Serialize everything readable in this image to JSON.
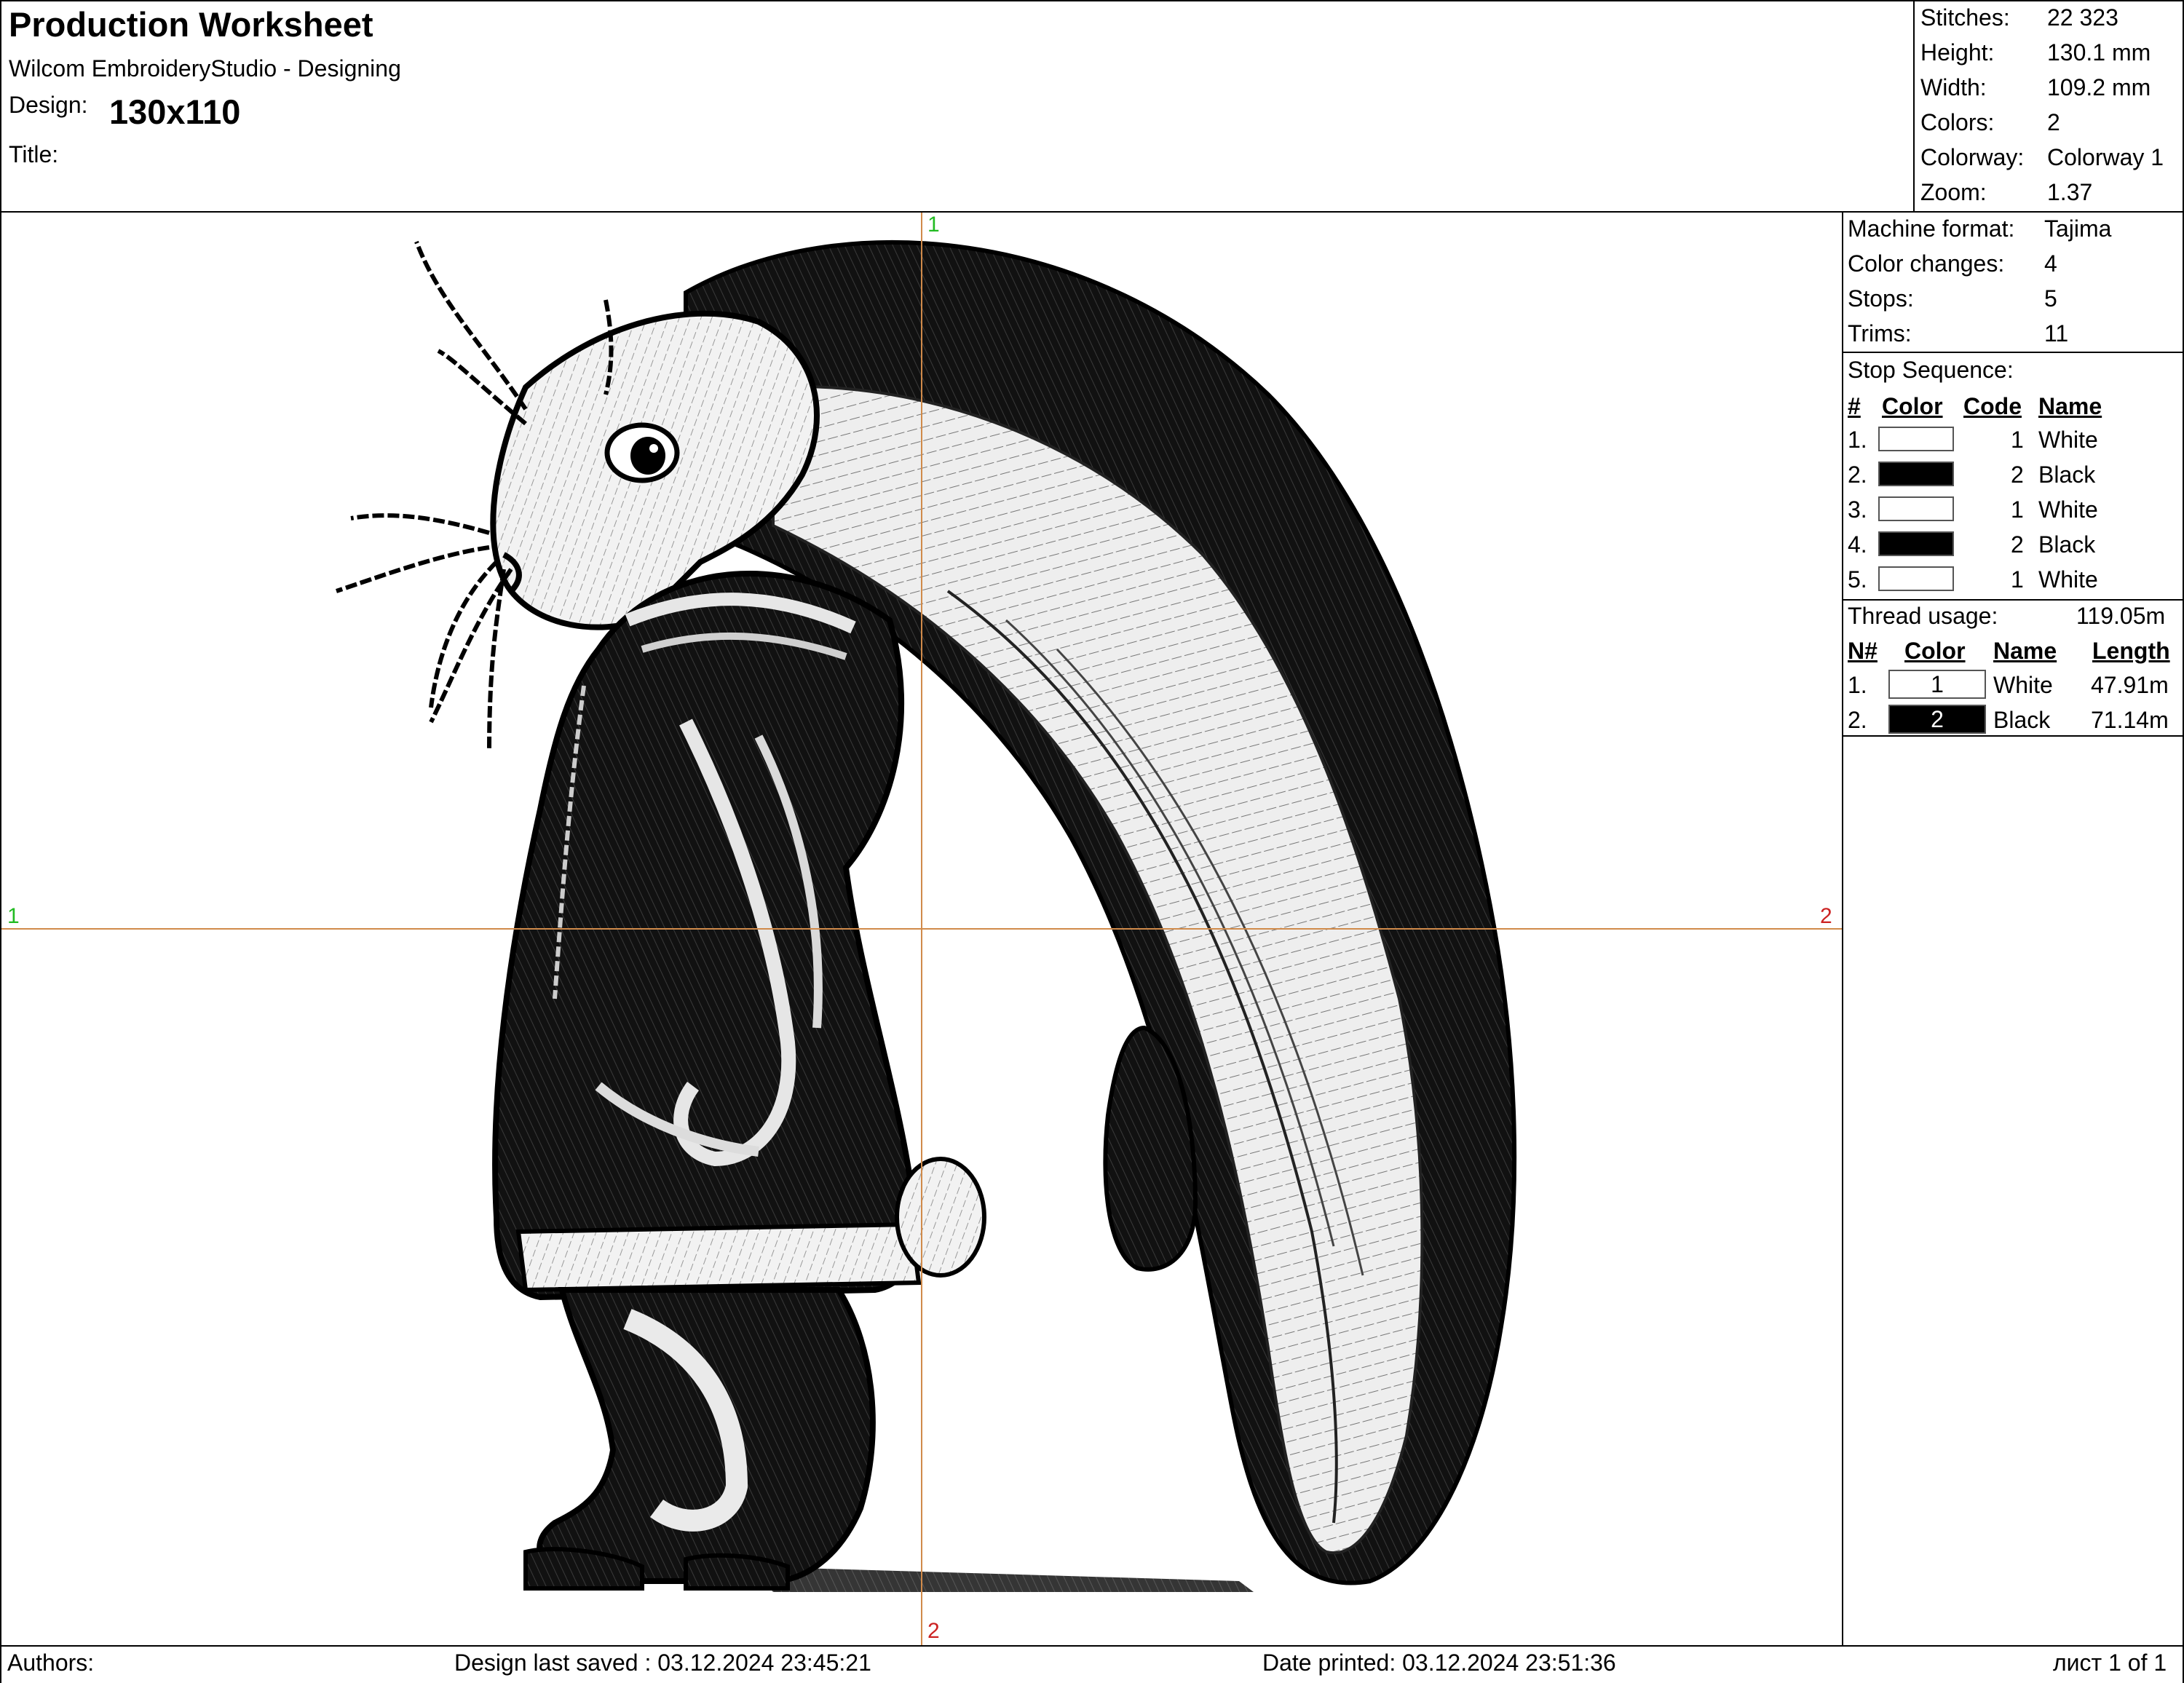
{
  "header": {
    "title": "Production Worksheet",
    "app": "Wilcom EmbroideryStudio - Designing",
    "design_label": "Design:",
    "design_value": "130x110",
    "title_label": "Title:"
  },
  "stats": [
    {
      "label": "Stitches:",
      "value": "22 323"
    },
    {
      "label": "Height:",
      "value": "130.1 mm"
    },
    {
      "label": "Width:",
      "value": "109.2 mm"
    },
    {
      "label": "Colors:",
      "value": "2"
    },
    {
      "label": "Colorway:",
      "value": "Colorway 1"
    },
    {
      "label": "Zoom:",
      "value": "1.37"
    }
  ],
  "machine": [
    {
      "label": "Machine format:",
      "value": "Tajima"
    },
    {
      "label": "Color changes:",
      "value": "4"
    },
    {
      "label": "Stops:",
      "value": "5"
    },
    {
      "label": "Trims:",
      "value": "11"
    }
  ],
  "stop_sequence": {
    "label": "Stop Sequence:",
    "headers": [
      "#",
      "Color",
      "Code",
      "Name"
    ],
    "rows": [
      {
        "n": "1.",
        "color": "#ffffff",
        "code": "1",
        "name": "White"
      },
      {
        "n": "2.",
        "color": "#000000",
        "code": "2",
        "name": "Black"
      },
      {
        "n": "3.",
        "color": "#ffffff",
        "code": "1",
        "name": "White"
      },
      {
        "n": "4.",
        "color": "#000000",
        "code": "2",
        "name": "Black"
      },
      {
        "n": "5.",
        "color": "#ffffff",
        "code": "1",
        "name": "White"
      }
    ]
  },
  "thread": {
    "label": "Thread usage:",
    "total": "119.05m",
    "headers": [
      "N#",
      "Color",
      "Name",
      "Length"
    ],
    "rows": [
      {
        "n": "1.",
        "code": "1",
        "color": "#ffffff",
        "text_color": "#000000",
        "name": "White",
        "length": "47.91m"
      },
      {
        "n": "2.",
        "code": "2",
        "color": "#000000",
        "text_color": "#ffffff",
        "name": "Black",
        "length": "71.14m"
      }
    ]
  },
  "markers": {
    "top": "1",
    "left": "1",
    "right": "2",
    "bottom": "2"
  },
  "footer": {
    "authors": "Authors:",
    "saved": "Design last saved : 03.12.2024 23:45:21",
    "printed": "Date printed: 03.12.2024 23:51:36",
    "page": "лист 1 of 1"
  }
}
